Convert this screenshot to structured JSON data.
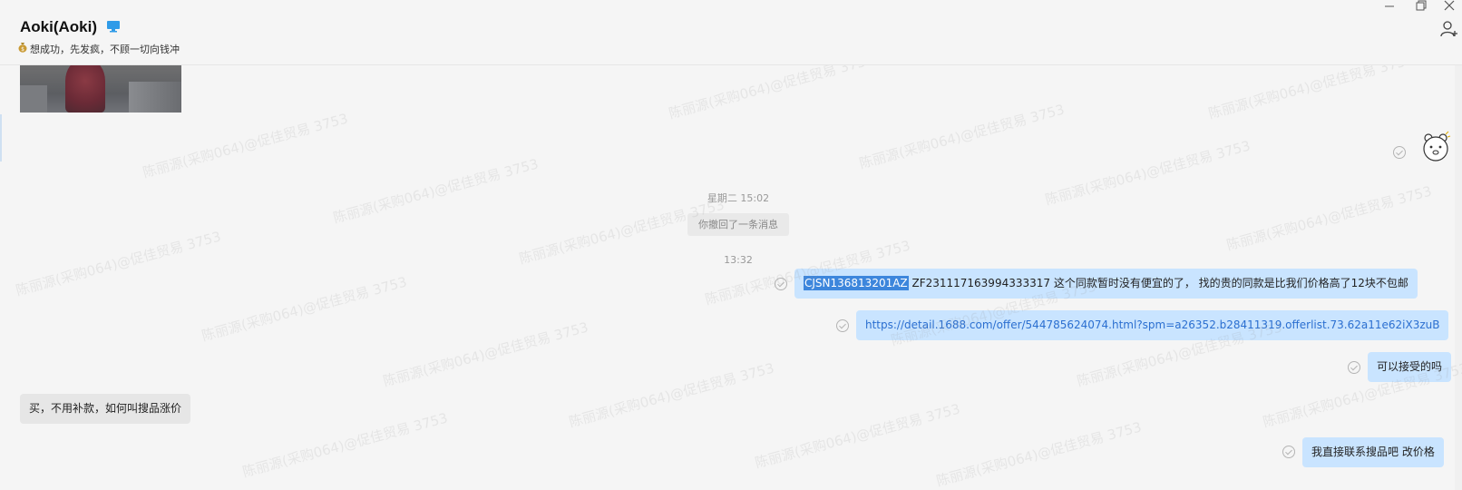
{
  "header": {
    "contact_name": "Aoki(Aoki)",
    "signature": "想成功，先发疯，不顾一切向钱冲",
    "device_icon": "monitor-icon",
    "signature_icon": "money-bag-icon",
    "add_contact_icon": "add-user-icon"
  },
  "window_controls": [
    "minimize-icon",
    "restore-icon",
    "close-icon"
  ],
  "messages": {
    "image_message": "chat-image",
    "sticker": "bear-sticker",
    "time_1": "星期二 15:02",
    "system_recall": "你撤回了一条消息",
    "time_2": "13:32",
    "out_1_selected": "CJSN136813201AZ",
    "out_1_rest": "  ZF231117163994333317  这个同款暂时没有便宜的了，  找的贵的同款是比我们价格高了12块不包邮",
    "out_2_link": "https://detail.1688.com/offer/544785624074.html?spm=a26352.b28411319.offerlist.73.62a11e62iX3zuB",
    "out_3": "可以接受的吗",
    "in_1": "买，不用补款，如何叫搜品涨价",
    "out_4": "我直接联系搜品吧  改价格"
  },
  "watermark": "陈丽源(采购064)@促佳贸易 3753",
  "colors": {
    "background": "#f5f5f5",
    "outgoing_bubble": "#c9e4ff",
    "incoming_bubble": "#e6e6e6",
    "selection": "#3d86dc",
    "link": "#2b6fd0"
  }
}
